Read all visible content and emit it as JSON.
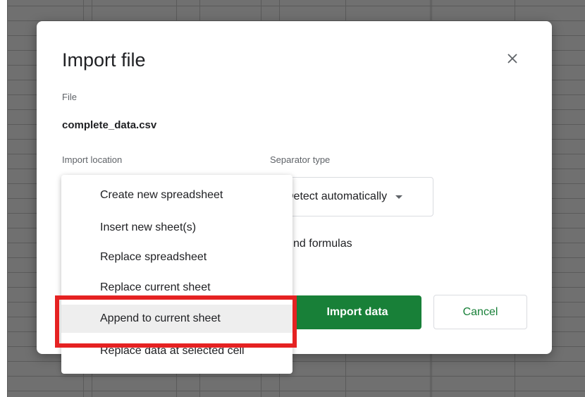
{
  "dialog": {
    "title": "Import file",
    "file_label": "File",
    "file_name": "complete_data.csv",
    "import_location_label": "Import location",
    "separator_label": "Separator type",
    "separator_value": "Detect automatically",
    "formula_text_partial": "nd formulas",
    "import_button": "Import data",
    "cancel_button": "Cancel"
  },
  "location_menu": {
    "items": [
      {
        "label": "Create new spreadsheet"
      },
      {
        "label": "Insert new sheet(s)"
      },
      {
        "label": "Replace spreadsheet"
      },
      {
        "label": "Replace current sheet"
      },
      {
        "label": "Append to current sheet",
        "highlighted": true
      },
      {
        "label": "Replace data at selected cell"
      }
    ]
  },
  "colors": {
    "accent_green": "#188038",
    "highlight_red": "#e52222",
    "overlay_gray": "#707070"
  },
  "icons": {
    "close": "close-icon",
    "dropdown": "chevron-down-icon"
  }
}
